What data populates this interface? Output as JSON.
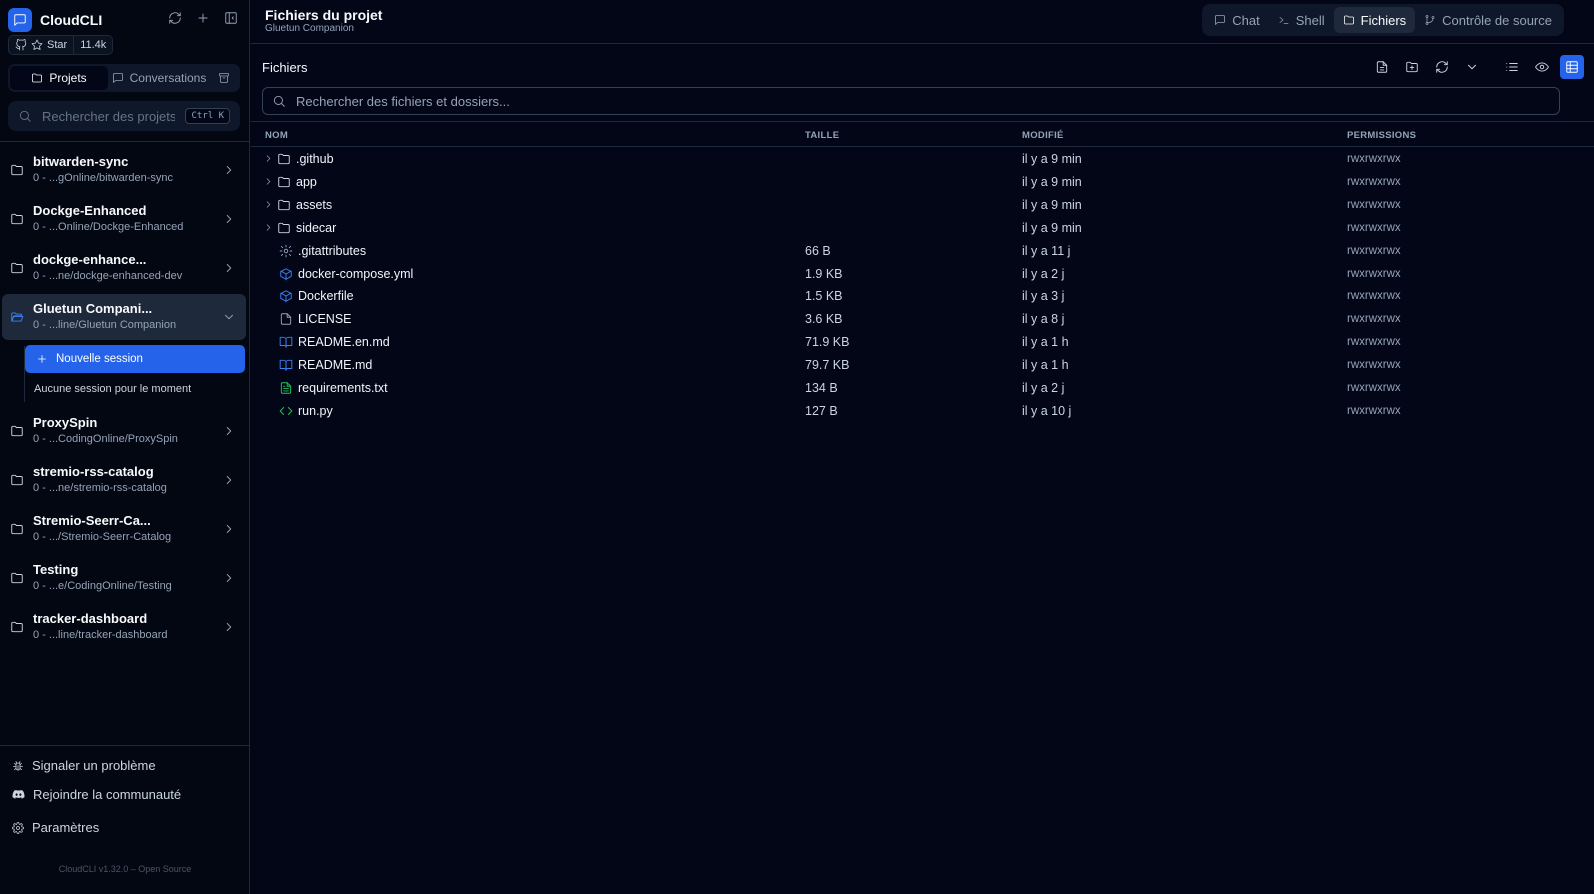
{
  "app": {
    "name": "CloudCLI",
    "star_label": "Star",
    "star_count": "11.4k"
  },
  "sidebar": {
    "tabs": [
      {
        "label": "Projets",
        "active": true
      },
      {
        "label": "Conversations",
        "active": false
      }
    ],
    "search_placeholder": "Rechercher des projets...",
    "search_shortcut": "Ctrl K",
    "projects": [
      {
        "name": "bitwarden-sync",
        "meta": "0  -  ...gOnline/bitwarden-sync",
        "expanded": false
      },
      {
        "name": "Dockge-Enhanced",
        "meta": "0  -  ...Online/Dockge-Enhanced",
        "expanded": false
      },
      {
        "name": "dockge-enhance...",
        "meta": "0  -  ...ne/dockge-enhanced-dev",
        "expanded": false
      },
      {
        "name": "Gluetun Compani...",
        "meta": "0  -  ...line/Gluetun Companion",
        "expanded": true
      },
      {
        "name": "ProxySpin",
        "meta": "0  -  ...CodingOnline/ProxySpin",
        "expanded": false
      },
      {
        "name": "stremio-rss-catalog",
        "meta": "0  -  ...ne/stremio-rss-catalog",
        "expanded": false
      },
      {
        "name": "Stremio-Seerr-Ca...",
        "meta": "0  -  .../Stremio-Seerr-Catalog",
        "expanded": false
      },
      {
        "name": "Testing",
        "meta": "0  -  ...e/CodingOnline/Testing",
        "expanded": false
      },
      {
        "name": "tracker-dashboard",
        "meta": "0  -  ...line/tracker-dashboard",
        "expanded": false
      }
    ],
    "new_session_label": "Nouvelle session",
    "no_session_text": "Aucune session pour le moment",
    "footer": {
      "report": "Signaler un problème",
      "community": "Rejoindre la communauté",
      "settings": "Paramètres",
      "version": "CloudCLI v1.32.0 – Open Source"
    }
  },
  "header": {
    "title": "Fichiers du projet",
    "subtitle": "Gluetun Companion",
    "tabs": [
      {
        "label": "Chat",
        "icon": "chat-icon",
        "active": false
      },
      {
        "label": "Shell",
        "icon": "terminal-icon",
        "active": false
      },
      {
        "label": "Fichiers",
        "icon": "folder-icon",
        "active": true
      },
      {
        "label": "Contrôle de source",
        "icon": "git-branch-icon",
        "active": false
      }
    ]
  },
  "files": {
    "label": "Fichiers",
    "search_placeholder": "Rechercher des fichiers et dossiers...",
    "columns": {
      "name": "NOM",
      "size": "TAILLE",
      "modified": "MODIFIÉ",
      "permissions": "PERMISSIONS"
    },
    "rows": [
      {
        "name": ".github",
        "type": "folder",
        "size": "",
        "modified": "il y a 9 min",
        "permissions": "rwxrwxrwx",
        "icon_color": "#cbd5e1"
      },
      {
        "name": "app",
        "type": "folder",
        "size": "",
        "modified": "il y a 9 min",
        "permissions": "rwxrwxrwx",
        "icon_color": "#cbd5e1"
      },
      {
        "name": "assets",
        "type": "folder",
        "size": "",
        "modified": "il y a 9 min",
        "permissions": "rwxrwxrwx",
        "icon_color": "#cbd5e1"
      },
      {
        "name": "sidecar",
        "type": "folder",
        "size": "",
        "modified": "il y a 9 min",
        "permissions": "rwxrwxrwx",
        "icon_color": "#cbd5e1"
      },
      {
        "name": ".gitattributes",
        "type": "gear",
        "size": "66 B",
        "modified": "il y a 11 j",
        "permissions": "rwxrwxrwx",
        "icon_color": "#94a3b8"
      },
      {
        "name": "docker-compose.yml",
        "type": "box",
        "size": "1.9 KB",
        "modified": "il y a 2 j",
        "permissions": "rwxrwxrwx",
        "icon_color": "#3b82f6"
      },
      {
        "name": "Dockerfile",
        "type": "box",
        "size": "1.5 KB",
        "modified": "il y a 3 j",
        "permissions": "rwxrwxrwx",
        "icon_color": "#3b82f6"
      },
      {
        "name": "LICENSE",
        "type": "file",
        "size": "3.6 KB",
        "modified": "il y a 8 j",
        "permissions": "rwxrwxrwx",
        "icon_color": "#94a3b8"
      },
      {
        "name": "README.en.md",
        "type": "book",
        "size": "71.9 KB",
        "modified": "il y a 1 h",
        "permissions": "rwxrwxrwx",
        "icon_color": "#3b82f6"
      },
      {
        "name": "README.md",
        "type": "book",
        "size": "79.7 KB",
        "modified": "il y a 1 h",
        "permissions": "rwxrwxrwx",
        "icon_color": "#3b82f6"
      },
      {
        "name": "requirements.txt",
        "type": "text",
        "size": "134 B",
        "modified": "il y a 2 j",
        "permissions": "rwxrwxrwx",
        "icon_color": "#22c55e"
      },
      {
        "name": "run.py",
        "type": "code",
        "size": "127 B",
        "modified": "il y a 10 j",
        "permissions": "rwxrwxrwx",
        "icon_color": "#22c55e"
      }
    ]
  },
  "colors": {
    "accent": "#2563eb",
    "background": "#020617",
    "sidebar": "#030712"
  }
}
